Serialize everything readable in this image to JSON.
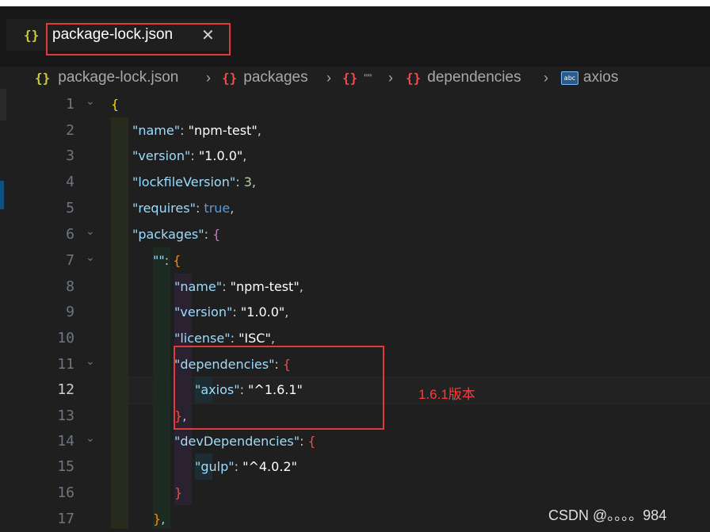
{
  "tab": {
    "icon": "{}",
    "label": "package-lock.json",
    "close": "✕"
  },
  "breadcrumb": {
    "items": [
      {
        "icon": "{}",
        "label": "package-lock.json"
      },
      {
        "icon": "{}",
        "label": "packages"
      },
      {
        "icon": "{}",
        "label": "\"\""
      },
      {
        "icon": "{}",
        "label": "dependencies"
      },
      {
        "icon": "abc",
        "label": "axios"
      }
    ],
    "separator": "›"
  },
  "editor": {
    "active_line": "12",
    "lines": [
      {
        "n": "1",
        "fold": "⌄"
      },
      {
        "n": "2"
      },
      {
        "n": "3"
      },
      {
        "n": "4"
      },
      {
        "n": "5"
      },
      {
        "n": "6",
        "fold": "⌄"
      },
      {
        "n": "7",
        "fold": "⌄"
      },
      {
        "n": "8"
      },
      {
        "n": "9"
      },
      {
        "n": "10"
      },
      {
        "n": "11",
        "fold": "⌄"
      },
      {
        "n": "12"
      },
      {
        "n": "13"
      },
      {
        "n": "14",
        "fold": "⌄"
      },
      {
        "n": "15"
      },
      {
        "n": "16"
      },
      {
        "n": "17"
      }
    ],
    "code": {
      "l1": "{",
      "l2_key": "\"name\"",
      "l2_val": "\"npm-test\"",
      "l3_key": "\"version\"",
      "l3_val": "\"1.0.0\"",
      "l4_key": "\"lockfileVersion\"",
      "l4_val": "3",
      "l5_key": "\"requires\"",
      "l5_val": "true",
      "l6_key": "\"packages\"",
      "l6_brace": "{",
      "l7_key": "\"\"",
      "l7_brace": "{",
      "l8_key": "\"name\"",
      "l8_val": "\"npm-test\"",
      "l9_key": "\"version\"",
      "l9_val": "\"1.0.0\"",
      "l10_key": "\"license\"",
      "l10_val": "\"ISC\"",
      "l11_key": "\"dependencies\"",
      "l11_brace": "{",
      "l12_key": "\"axios\"",
      "l12_val": "\"^1.6.1\"",
      "l13": "}",
      "l14_key": "\"devDependencies\"",
      "l14_brace": "{",
      "l15_key": "\"gulp\"",
      "l15_val": "\"^4.0.2\"",
      "l16": "}",
      "l17": "}"
    }
  },
  "annotation": "1.6.1版本",
  "watermark": "CSDN @。。。。984",
  "colors": {
    "highlight_box": "#e3393c",
    "annotation": "#ff3b3b"
  }
}
